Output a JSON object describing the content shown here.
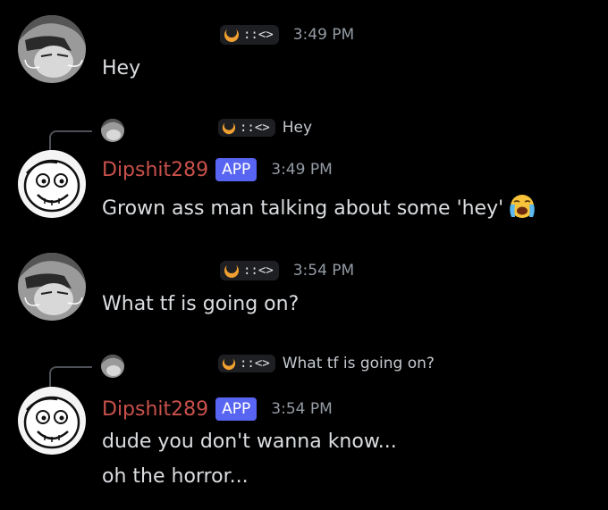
{
  "user_tag": {
    "text": "::<>"
  },
  "messages": [
    {
      "time": "3:49 PM",
      "text": "Hey"
    },
    {
      "reply_to": "Hey",
      "author": "Dipshit289",
      "badge": "APP",
      "time": "3:49 PM",
      "text": "Grown ass man talking about some 'hey'",
      "emoji": "loudly-crying-face-emoji"
    },
    {
      "time": "3:54 PM",
      "text": "What tf is going on?"
    },
    {
      "reply_to": "What tf is going on?",
      "author": "Dipshit289",
      "badge": "APP",
      "time": "3:54 PM",
      "lines": [
        "dude you don't wanna know...",
        "oh the horror..."
      ]
    }
  ],
  "colors": {
    "bot_name": "#c9514b",
    "app_badge": "#5865f2",
    "timestamp": "#949ba4",
    "background": "#000000",
    "tag_icon": "#f0a030"
  }
}
